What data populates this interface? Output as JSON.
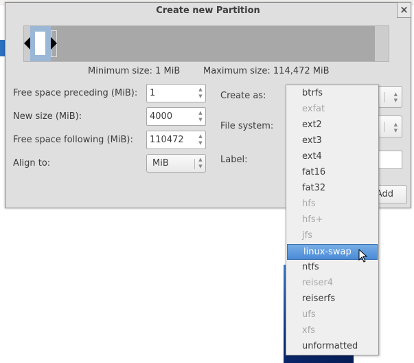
{
  "dialog": {
    "title": "Create new Partition",
    "close_label": "×"
  },
  "partition_bar": {
    "min_label": "Minimum size: 1 MiB",
    "max_label": "Maximum size: 114,472 MiB"
  },
  "form": {
    "free_preceding": {
      "label": "Free space preceding (MiB):",
      "value": "1"
    },
    "new_size": {
      "label": "New size (MiB):",
      "value": "4000"
    },
    "free_following": {
      "label": "Free space following (MiB):",
      "value": "110472"
    },
    "align_to": {
      "label": "Align to:",
      "value": "MiB"
    },
    "create_as": {
      "label": "Create as:"
    },
    "file_system": {
      "label": "File system:"
    },
    "label": {
      "label": "Label:",
      "value": ""
    },
    "add_button": "Add",
    "add_button_visible": "dd"
  },
  "menu": {
    "items": [
      {
        "label": "btrfs",
        "enabled": true
      },
      {
        "label": "exfat",
        "enabled": false
      },
      {
        "label": "ext2",
        "enabled": true
      },
      {
        "label": "ext3",
        "enabled": true
      },
      {
        "label": "ext4",
        "enabled": true
      },
      {
        "label": "fat16",
        "enabled": true
      },
      {
        "label": "fat32",
        "enabled": true
      },
      {
        "label": "hfs",
        "enabled": false
      },
      {
        "label": "hfs+",
        "enabled": false
      },
      {
        "label": "jfs",
        "enabled": false
      },
      {
        "label": "linux-swap",
        "enabled": true,
        "selected": true
      },
      {
        "label": "ntfs",
        "enabled": true
      },
      {
        "label": "reiser4",
        "enabled": false
      },
      {
        "label": "reiserfs",
        "enabled": true
      },
      {
        "label": "ufs",
        "enabled": false
      },
      {
        "label": "xfs",
        "enabled": false
      },
      {
        "label": "unformatted",
        "enabled": true
      }
    ]
  },
  "colors": {
    "selection": "#4a8ad6",
    "partition": "#9bb7d6",
    "unallocated": "#a8a8a8"
  }
}
